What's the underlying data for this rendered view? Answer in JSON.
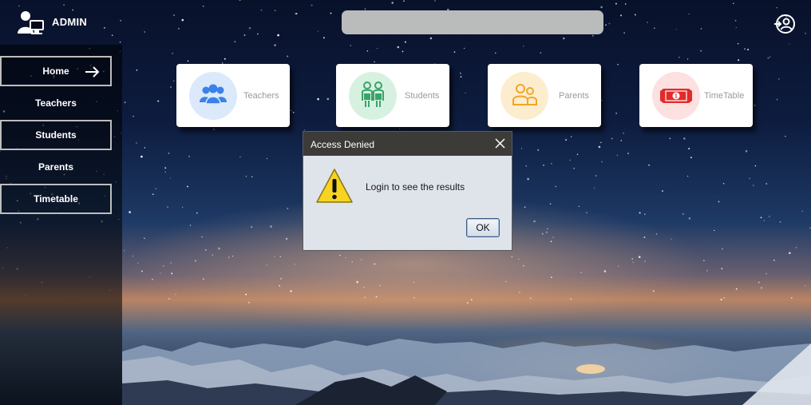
{
  "header": {
    "admin_label": "ADMIN",
    "admin_icon": "admin-user-icon",
    "search_value": "",
    "login_icon": "account-login-icon"
  },
  "sidebar": {
    "items": [
      {
        "label": "Home",
        "active": true,
        "icon": "arrow-right-icon"
      },
      {
        "label": "Teachers"
      },
      {
        "label": "Students"
      },
      {
        "label": "Parents"
      },
      {
        "label": "Timetable"
      }
    ]
  },
  "cards": [
    {
      "label": "Teachers",
      "icon": "teachers-group-icon",
      "circle_color": "#dbe9fb",
      "icon_color": "#3a82e8"
    },
    {
      "label": "Students",
      "icon": "students-icon",
      "circle_color": "#d7f1e1",
      "icon_color": "#3aa36a"
    },
    {
      "label": "Parents",
      "icon": "parents-icon",
      "circle_color": "#fdedcf",
      "icon_color": "#f2a623"
    },
    {
      "label": "TimeTable",
      "icon": "money-icon",
      "circle_color": "#fde0e0",
      "icon_color": "#e32a2a"
    }
  ],
  "dialog": {
    "title": "Access Denied",
    "message": "Login to see the results",
    "ok_label": "OK",
    "icon": "warning-icon"
  }
}
